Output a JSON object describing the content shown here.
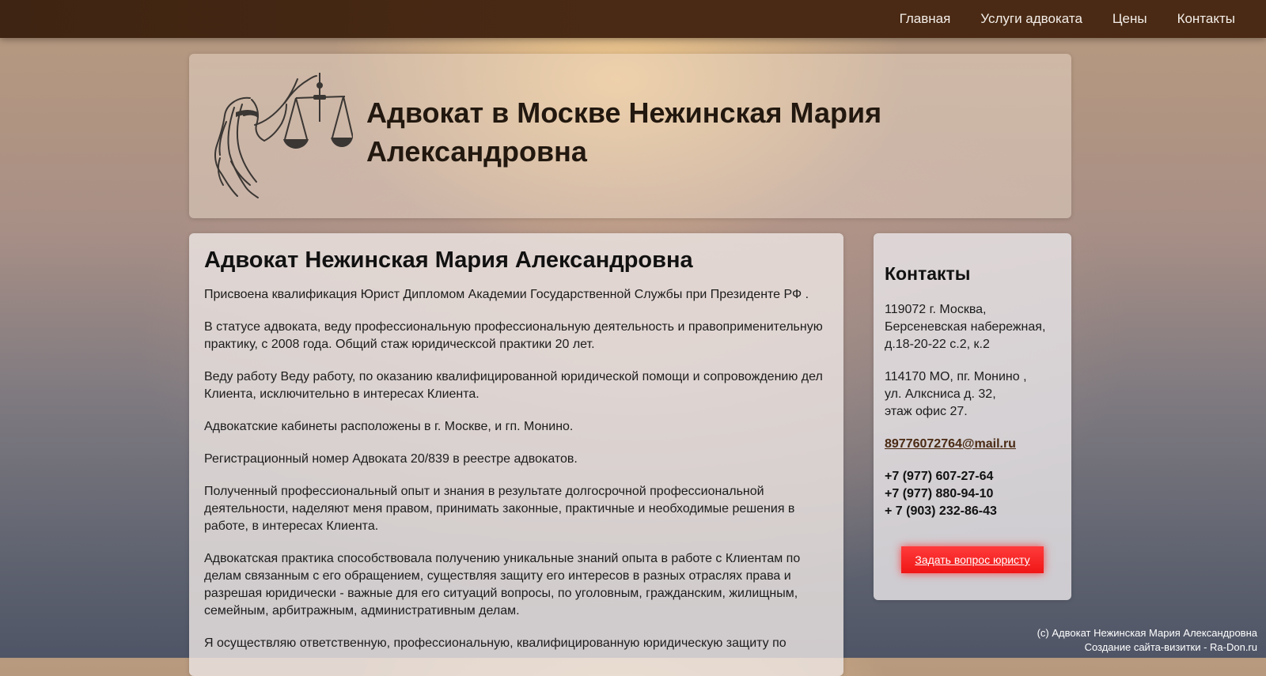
{
  "nav": {
    "items": [
      "Главная",
      "Услуги адвоката",
      "Цены",
      "Контакты"
    ]
  },
  "header": {
    "title": "Адвокат в Москве Нежинская Мария Александровна"
  },
  "main": {
    "heading": "Адвокат Нежинская Мария Александровна",
    "paragraphs": [
      "Присвоена квалификация Юрист Дипломом Академии Государственной Службы при Президенте РФ .",
      "В статусе адвоката, веду профессиональную профессиональную деятельность и правоприменительную практику, с 2008 года. Общий стаж юридическсой практики 20 лет.",
      "Веду работу Веду работу, по оказанию квалифицированной юридической помощи и сопровождению дел Клиента, исключительно в интересах Клиента.",
      "Адвокатские кабинеты расположены в г. Москве, и гп. Монино.",
      "Регистрационный номер Адвоката 20/839 в реестре адвокатов.",
      "Полученный профессиональный опыт и знания в результате долгосрочной профессиональной деятельности, наделяют меня правом, принимать законные, практичные и необходимые решения в работе, в интересах Клиента.",
      "Адвокатская практика способствовала получению уникальные знаний опыта в работе с Клиентам по делам связанным с его обращением, существляя защиту его интересов в разных отраслях права и разрешая юридически - важные для его ситуаций вопросы, по уголовным, гражданским, жилищным, семейным, арбитражным, административным делам.",
      "Я осуществляю ответственную, профессиональную, квалифицированную юридическую защиту по"
    ]
  },
  "contacts": {
    "heading": "Контакты",
    "address1": [
      "119072 г. Москва,",
      "Берсеневская набережная,",
      "д.18-20-22 с.2, к.2"
    ],
    "address2": [
      "114170 МО, пг. Монино ,",
      "ул. Алксниса д. 32,",
      "этаж офис 27."
    ],
    "email_user": "89776072764",
    "email_domain": "@mail.ru",
    "phones": [
      "+7 (977) 607-27-64",
      "+7 (977) 880-94-10",
      "+ 7 (903) 232-86-43"
    ],
    "ask_button": "Задать вопрос юристу"
  },
  "footer": {
    "copyright": "(c) Адвокат Нежинская Мария Александровна",
    "credit": "Создание сайта-визитки - Ra-Don.ru"
  }
}
